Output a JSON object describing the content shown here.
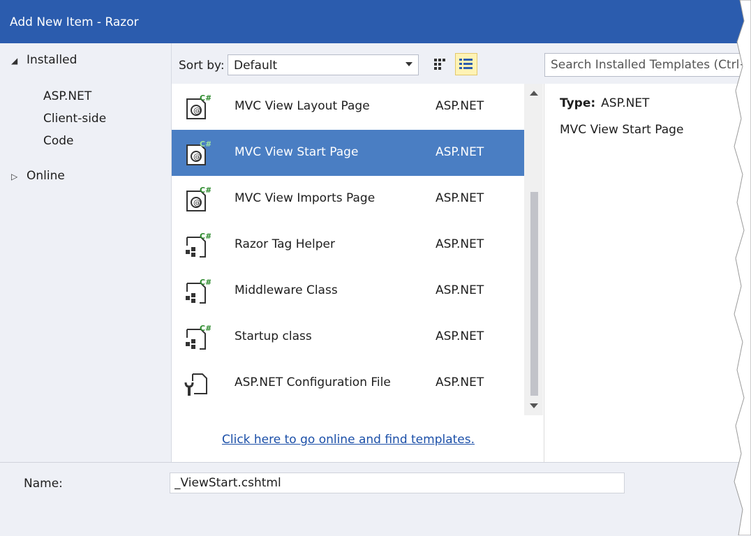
{
  "window": {
    "title": "Add New Item - Razor"
  },
  "tree": {
    "installed": {
      "label": "Installed",
      "expanded": true
    },
    "children": [
      {
        "label": "ASP.NET",
        "selected": true
      },
      {
        "label": "Client-side",
        "selected": false
      },
      {
        "label": "Code",
        "selected": false
      }
    ],
    "online": {
      "label": "Online",
      "expanded": false
    }
  },
  "toolbar": {
    "sort_label": "Sort by:",
    "sort_value": "Default",
    "search_placeholder": "Search Installed Templates (Ctrl+E)"
  },
  "templates": [
    {
      "name": "MVC View Layout Page",
      "category": "ASP.NET",
      "icon": "razor-page-icon",
      "selected": false
    },
    {
      "name": "MVC View Start Page",
      "category": "ASP.NET",
      "icon": "razor-page-icon",
      "selected": true
    },
    {
      "name": "MVC View Imports Page",
      "category": "ASP.NET",
      "icon": "razor-page-icon",
      "selected": false
    },
    {
      "name": "Razor Tag Helper",
      "category": "ASP.NET",
      "icon": "class-icon",
      "selected": false
    },
    {
      "name": "Middleware Class",
      "category": "ASP.NET",
      "icon": "class-icon",
      "selected": false
    },
    {
      "name": "Startup class",
      "category": "ASP.NET",
      "icon": "class-icon",
      "selected": false
    },
    {
      "name": "ASP.NET Configuration File",
      "category": "ASP.NET",
      "icon": "config-file-icon",
      "selected": false
    }
  ],
  "online_link": "Click here to go online and find templates.",
  "details": {
    "type_label": "Type:",
    "type_value": "ASP.NET",
    "description": "MVC View Start Page"
  },
  "name_field": {
    "label": "Name:",
    "value": "_ViewStart.cshtml"
  },
  "colors": {
    "titlebar": "#2b5cae",
    "selection": "#4a7ec3",
    "csharp_badge": "#2e8b2e",
    "link": "#1b4fa8"
  }
}
